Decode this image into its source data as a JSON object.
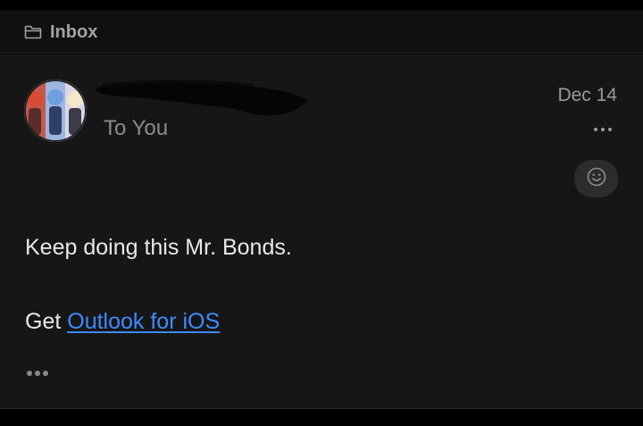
{
  "folder": {
    "icon": "folder-icon",
    "label": "Inbox"
  },
  "message": {
    "avatar": "sender-avatar",
    "sender_redacted": true,
    "recipient": "To You",
    "date": "Dec 14",
    "actions": {
      "more_icon": "more-horizontal-icon",
      "reaction_icon": "smiley-icon"
    },
    "body": {
      "line1": "Keep doing this Mr. Bonds.",
      "signature_prefix": "Get ",
      "signature_link": "Outlook for iOS"
    },
    "expand_icon": "ellipsis-icon"
  },
  "colors": {
    "background": "#000000",
    "card": "#161616",
    "folder_bar": "#101010",
    "link": "#3d8bff",
    "text_primary": "#e8e8e8",
    "text_secondary": "#8c8c8c"
  }
}
